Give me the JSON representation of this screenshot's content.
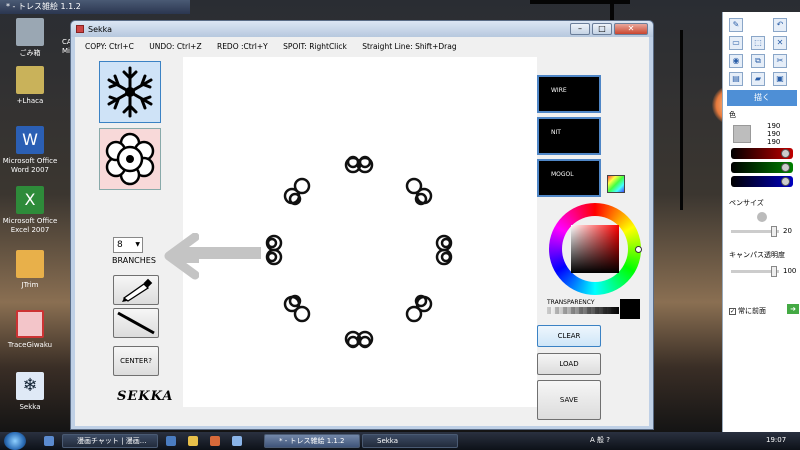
{
  "desktop": {
    "topstrip_title": "* - トレス雑絵 1.1.2",
    "icons": [
      {
        "label": "ごみ箱"
      },
      {
        "label": "+Lhaca"
      },
      {
        "label": "Microsoft Office Word 2007"
      },
      {
        "label": "Microsoft Office Excel 2007"
      },
      {
        "label": "JTrim"
      },
      {
        "label": "TraceGiwaku"
      },
      {
        "label": "Sekka"
      }
    ],
    "partial_labels": [
      "CA",
      "Mi"
    ]
  },
  "window": {
    "title": "Sekka",
    "controls": [
      "–",
      "□",
      "✕"
    ],
    "hints": [
      "COPY: Ctrl+C",
      "UNDO: Ctrl+Z",
      "REDO :Ctrl+Y",
      "SPOIT: RightClick",
      "Straight Line: Shift+Drag"
    ],
    "branches_value": "8",
    "branches_label": "BRANCHES",
    "center_label": "CENTER?",
    "logo_text": "SEKKA",
    "modes": [
      "WIRE",
      "NIT",
      "MOGOL"
    ],
    "transparency_label": "TRANSPARENCY",
    "buttons": {
      "clear": "CLEAR",
      "load": "LOAD",
      "save": "SAVE"
    }
  },
  "panel": {
    "draw_label": "描く",
    "color_label": "色",
    "rgb": [
      "190",
      "190",
      "190"
    ],
    "pen_size_label": "ペンサイズ",
    "pen_size_value": "20",
    "opacity_label": "キャンパス透明度",
    "opacity_value": "100",
    "always_on_top_label": "常に前面",
    "colors": {
      "red": "#c00000",
      "green": "#008000",
      "blue": "#0000c0"
    }
  },
  "taskbar": {
    "items": [
      "漫画チャット | 漫画...",
      "* - トレス雑絵 1.1.2",
      "Sekka"
    ],
    "tray_text": "A 般 ?",
    "clock": "19:07"
  }
}
